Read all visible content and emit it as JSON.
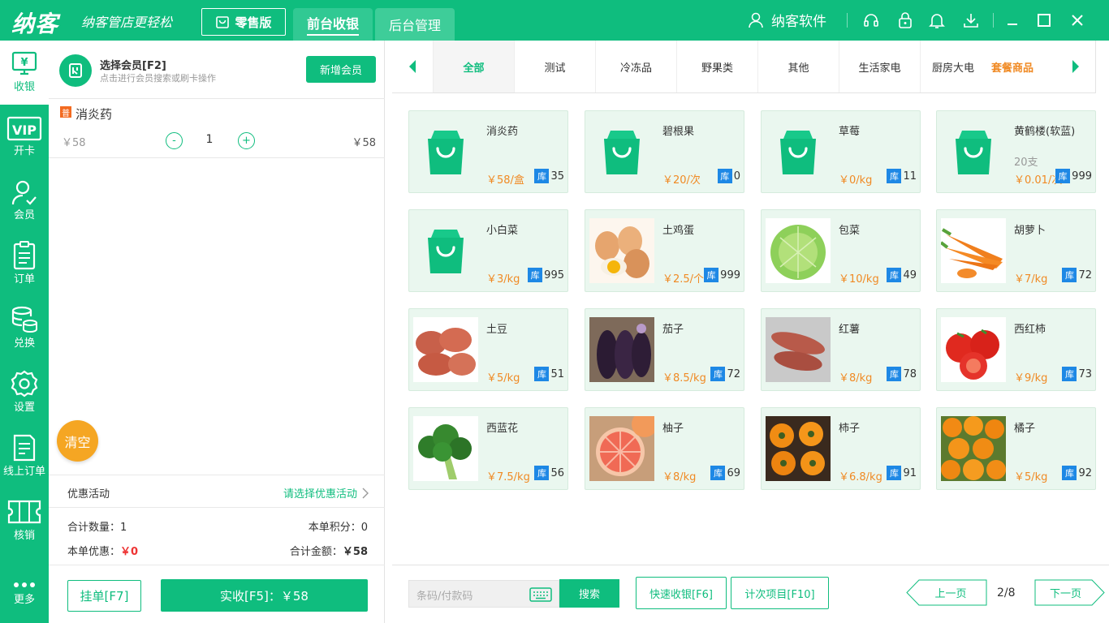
{
  "topbar": {
    "logo": "纳客",
    "slogan": "纳客管店更轻松",
    "edition": "零售版",
    "tabs": [
      {
        "label": "前台收银",
        "active": true
      },
      {
        "label": "后台管理",
        "active": false
      }
    ],
    "user": "纳客软件",
    "icons": [
      "headset-icon",
      "lock-icon",
      "bell-icon",
      "download-icon",
      "minimize-icon",
      "maximize-icon",
      "close-icon"
    ]
  },
  "sidebar": {
    "items": [
      {
        "label": "收银",
        "icon": "cashier-icon",
        "active": true
      },
      {
        "label": "开卡",
        "icon": "vip-card-icon"
      },
      {
        "label": "会员",
        "icon": "member-icon"
      },
      {
        "label": "订单",
        "icon": "order-icon"
      },
      {
        "label": "兑换",
        "icon": "exchange-icon"
      },
      {
        "label": "设置",
        "icon": "settings-icon"
      },
      {
        "label": "线上订单",
        "icon": "online-order-icon"
      },
      {
        "label": "核销",
        "icon": "ticket-icon"
      },
      {
        "label": "更多",
        "icon": "more-icon"
      }
    ]
  },
  "member": {
    "title": "选择会员[F2]",
    "subtitle": "点击进行会员搜索或刷卡操作",
    "add_button": "新增会员"
  },
  "cart": {
    "items": [
      {
        "badge": "普",
        "name": "消炎药",
        "unit_price": "￥58",
        "qty": "1",
        "total": "￥58",
        "minus": "-",
        "plus": "+"
      }
    ]
  },
  "clear_button": "清空",
  "promo": {
    "label": "优惠活动",
    "select": "请选择优惠活动"
  },
  "summary": {
    "qty_label": "合计数量：",
    "qty": "1",
    "points_label": "本单积分：",
    "points": "0",
    "discount_label": "本单优惠：",
    "discount": "￥0",
    "total_label": "合计金额：",
    "total": "￥58"
  },
  "footer": {
    "hold_button": "挂单[F7]",
    "pay_button": "实收[F5]：￥58"
  },
  "categories": [
    {
      "label": "全部",
      "active": true
    },
    {
      "label": "测试"
    },
    {
      "label": "冷冻品"
    },
    {
      "label": "野果类"
    },
    {
      "label": "其他"
    },
    {
      "label": "生活家电"
    },
    {
      "label": "厨房大电"
    },
    {
      "label": "套餐商品",
      "highlight": true
    }
  ],
  "products": [
    {
      "name": "消炎药",
      "price": "￥58/盒",
      "stock": "35",
      "image": "bag-icon"
    },
    {
      "name": "碧根果",
      "price": "￥20/次",
      "stock": "0",
      "image": "bag-icon"
    },
    {
      "name": "草莓",
      "price": "￥0/kg",
      "stock": "11",
      "image": "bag-icon"
    },
    {
      "name": "黄鹤楼(软蓝)",
      "sub": "20支",
      "price": "￥0.01/次",
      "stock": "999",
      "image": "bag-icon"
    },
    {
      "name": "小白菜",
      "price": "￥3/kg",
      "stock": "995",
      "image": "bag-icon"
    },
    {
      "name": "土鸡蛋",
      "price": "￥2.5/个",
      "stock": "999",
      "image": "eggs-photo"
    },
    {
      "name": "包菜",
      "price": "￥10/kg",
      "stock": "49",
      "image": "cabbage-photo"
    },
    {
      "name": "胡萝卜",
      "price": "￥7/kg",
      "stock": "72",
      "image": "carrot-photo"
    },
    {
      "name": "土豆",
      "price": "￥5/kg",
      "stock": "51",
      "image": "potato-photo"
    },
    {
      "name": "茄子",
      "price": "￥8.5/kg",
      "stock": "72",
      "image": "eggplant-photo"
    },
    {
      "name": "红薯",
      "price": "￥8/kg",
      "stock": "78",
      "image": "sweet-potato-photo"
    },
    {
      "name": "西红柿",
      "price": "￥9/kg",
      "stock": "73",
      "image": "tomato-photo"
    },
    {
      "name": "西蓝花",
      "price": "￥7.5/kg",
      "stock": "56",
      "image": "broccoli-photo"
    },
    {
      "name": "柚子",
      "price": "￥8/kg",
      "stock": "69",
      "image": "grapefruit-photo"
    },
    {
      "name": "柿子",
      "price": "￥6.8/kg",
      "stock": "91",
      "image": "persimmon-photo"
    },
    {
      "name": "橘子",
      "price": "￥5/kg",
      "stock": "92",
      "image": "orange-photo"
    }
  ],
  "stock_badge": "库",
  "bottom": {
    "scan_placeholder": "条码/付款码",
    "search_button": "搜索",
    "quick_button": "快速收银[F6]",
    "count_button": "计次项目[F10]",
    "prev": "上一页",
    "page": "2/8",
    "next": "下一页"
  },
  "colors": {
    "brand": "#0fbd7e",
    "price": "#f08a24",
    "stock": "#1e88e5",
    "clear": "#f5a623",
    "discount": "#e33333"
  }
}
